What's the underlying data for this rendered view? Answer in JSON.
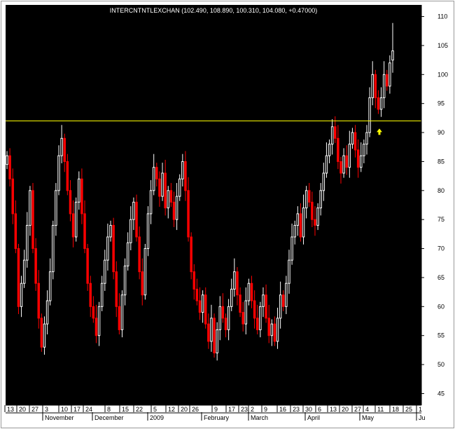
{
  "chart_data": {
    "type": "candlestick",
    "title": "INTERCNTNTLEXCHAN (102.490, 108.890, 100.310, 104.080, +0.47000)",
    "background": "#000000",
    "colors": {
      "up": "#ffffff",
      "down": "#ff0000",
      "resistance": "#ffff00",
      "arrow": "#ffff00",
      "wick": "#ffffff"
    },
    "y_axis": {
      "position": "right",
      "ticks": [
        45,
        50,
        55,
        60,
        65,
        70,
        75,
        80,
        85,
        90,
        95,
        100,
        105,
        110
      ],
      "ylim": [
        43,
        112
      ]
    },
    "x_day_labels": [
      "13",
      "20",
      "27",
      "3",
      "10",
      "17",
      "24",
      "8",
      "15",
      "22",
      "5",
      "12",
      "20",
      "26",
      "9",
      "17",
      "23",
      "2",
      "9",
      "16",
      "23",
      "30",
      "6",
      "13",
      "20",
      "27",
      "4",
      "11",
      "18",
      "25",
      "1"
    ],
    "x_month_labels": [
      "November",
      "December",
      "2009",
      "February",
      "March",
      "April",
      "May",
      "Ju"
    ],
    "horizontal_line": {
      "value": 92
    },
    "annotation_arrow": {
      "label": "up-arrow",
      "value": 90.2
    },
    "last_bar": {
      "open": 102.49,
      "high": 108.89,
      "low": 100.31,
      "close": 104.08,
      "change": 0.47
    },
    "closes": [
      86,
      82,
      76,
      70,
      60,
      64,
      68,
      74,
      80,
      70,
      64,
      58,
      53,
      57,
      61,
      66,
      74,
      80,
      86,
      89,
      85,
      80,
      76,
      72,
      78,
      82,
      76,
      70,
      64,
      60,
      58,
      55,
      60,
      64,
      68,
      72,
      74,
      66,
      60,
      56,
      62,
      67,
      71,
      75,
      78,
      72,
      66,
      62,
      70,
      76,
      80,
      84,
      82,
      79,
      83,
      77,
      80,
      78,
      75,
      79,
      82,
      85,
      80,
      72,
      66,
      63,
      61,
      59,
      62,
      57,
      54,
      58,
      52,
      56,
      60,
      58,
      56,
      60,
      63,
      66,
      62,
      59,
      57,
      61,
      64,
      61,
      58,
      56,
      60,
      62,
      58,
      55,
      57,
      54,
      58,
      62,
      60,
      64,
      68,
      72,
      74,
      76,
      72,
      77,
      80,
      78,
      75,
      74,
      77,
      80,
      83,
      86,
      88,
      91,
      89,
      85,
      83,
      86,
      84,
      88,
      90,
      87,
      84,
      86,
      88,
      90,
      96,
      100,
      96,
      94,
      96,
      100,
      98,
      102,
      104.08
    ]
  }
}
